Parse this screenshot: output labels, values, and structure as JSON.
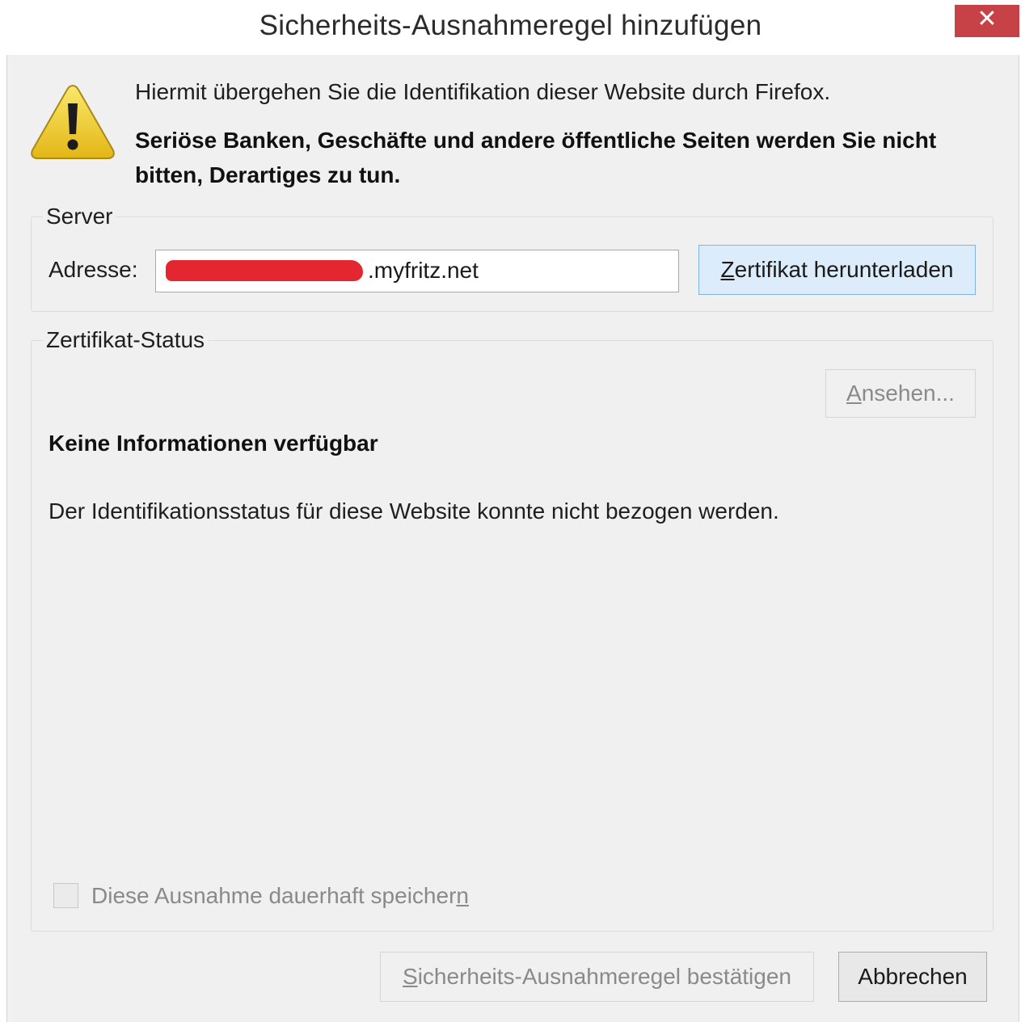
{
  "window": {
    "title": "Sicherheits-Ausnahmeregel hinzufügen",
    "close_glyph": "✕"
  },
  "warning": {
    "icon": "warning-triangle-icon",
    "line1": "Hiermit übergehen Sie die Identifikation dieser Website durch Firefox.",
    "line2": "Seriöse Banken, Geschäfte und andere öffentliche Seiten werden Sie nicht bitten, Derartiges zu tun."
  },
  "server": {
    "legend": "Server",
    "address_label": "Adresse:",
    "address_visible_value": ".myfritz.net",
    "download_button": {
      "label": "Zertifikat herunterladen",
      "accesskey": "Z"
    }
  },
  "certificate_status": {
    "legend": "Zertifikat-Status",
    "view_button": {
      "label": "Ansehen...",
      "accesskey": "A",
      "enabled": false
    },
    "heading": "Keine Informationen verfügbar",
    "description": "Der Identifikationsstatus für diese Website konnte nicht bezogen werden.",
    "permanent_checkbox": {
      "label": "Diese Ausnahme dauerhaft speichern",
      "accesskey": "n",
      "checked": false,
      "enabled": false
    }
  },
  "footer": {
    "confirm_button": {
      "label": "Sicherheits-Ausnahmeregel bestätigen",
      "accesskey": "S",
      "enabled": false
    },
    "cancel_button": {
      "label": "Abbrechen"
    }
  },
  "colors": {
    "close_button": "#c74247",
    "dialog_bg": "#f0f0f0",
    "primary_button_bg": "#dcecfb",
    "primary_button_border": "#7eb4ea",
    "redaction": "#e32630"
  }
}
